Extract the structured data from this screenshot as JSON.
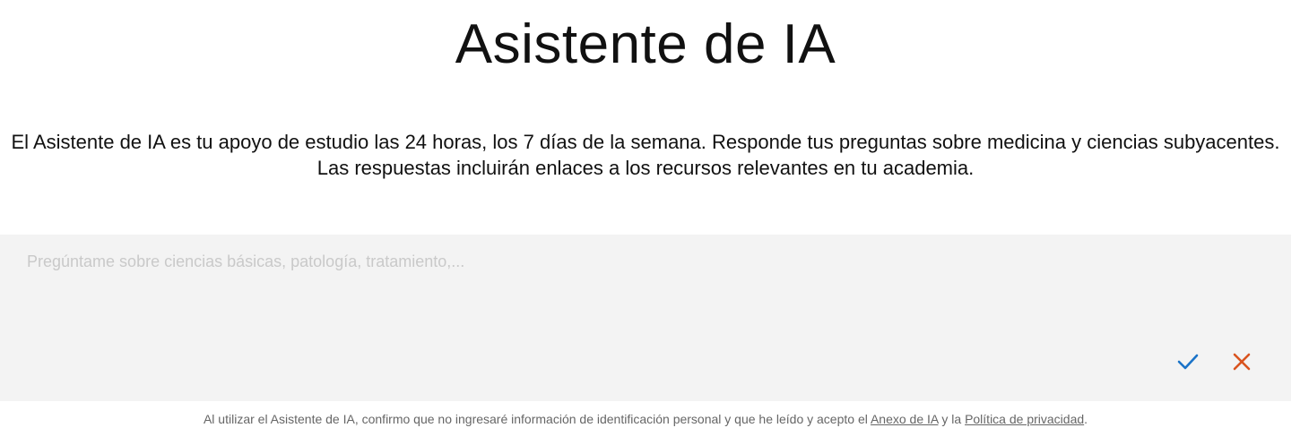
{
  "header": {
    "title": "Asistente de IA"
  },
  "intro": {
    "description": "El Asistente de IA es tu apoyo de estudio las 24 horas, los 7 días de la semana. Responde tus preguntas sobre medicina y ciencias subyacentes. Las respuestas incluirán enlaces a los recursos relevantes en tu academia."
  },
  "prompt": {
    "value": "",
    "placeholder": "Pregúntame sobre ciencias básicas, patología, tratamiento,..."
  },
  "actions": {
    "submit_icon": "checkmark-icon",
    "cancel_icon": "close-icon",
    "submit_color": "#1a73c8",
    "cancel_color": "#d9531e"
  },
  "disclaimer": {
    "text_before": "Al utilizar el Asistente de IA, confirmo que no ingresaré información de identificación personal y que he leído y acepto el ",
    "annex_link": "Anexo de IA",
    "text_middle": " y la ",
    "privacy_link": "Política de privacidad",
    "text_after": "."
  }
}
